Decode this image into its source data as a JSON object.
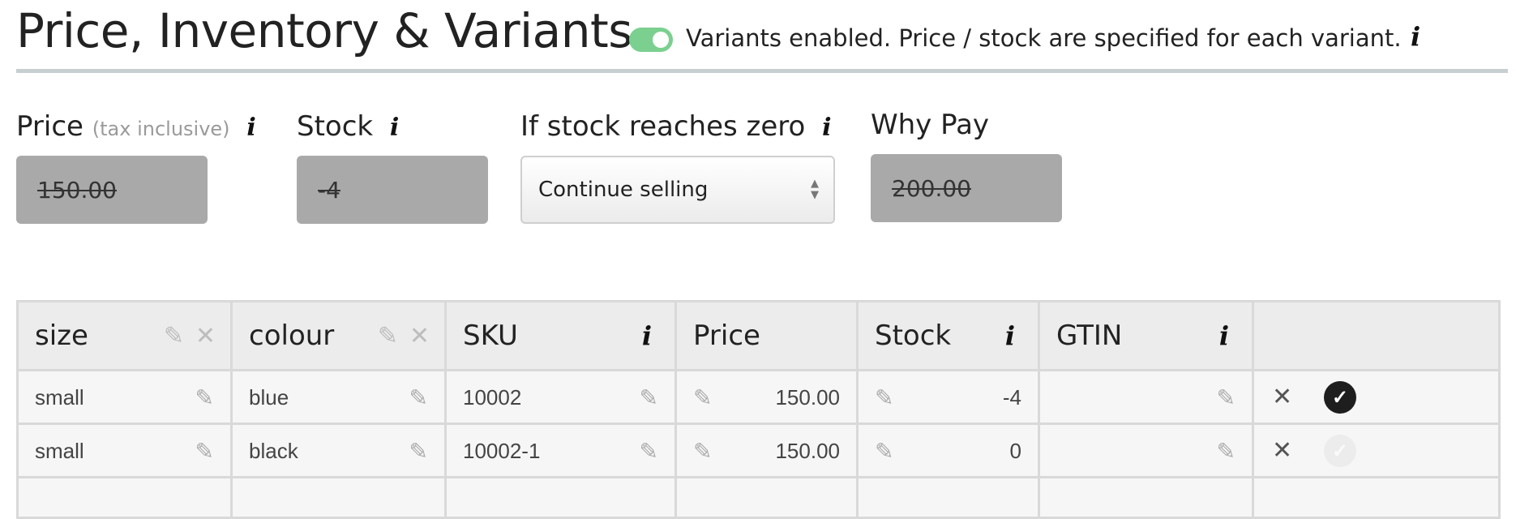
{
  "header": {
    "title": "Price, Inventory & Variants",
    "variants_toggle_on": true,
    "variants_message": "Variants enabled. Price / stock are specified for each variant.",
    "info_glyph": "i"
  },
  "fields": {
    "price_label": "Price",
    "price_sublabel": "(tax inclusive)",
    "price_value": "150.00",
    "stock_label": "Stock",
    "stock_value": "-4",
    "zero_label": "If stock reaches zero",
    "zero_selected": "Continue selling",
    "why_pay_label": "Why Pay",
    "why_pay_value": "200.00"
  },
  "table": {
    "headers": {
      "size": "size",
      "colour": "colour",
      "sku": "SKU",
      "price": "Price",
      "stock": "Stock",
      "gtin": "GTIN"
    },
    "rows": [
      {
        "size": "small",
        "colour": "blue",
        "sku": "10002",
        "price": "150.00",
        "stock": "-4",
        "gtin": "",
        "active": true
      },
      {
        "size": "small",
        "colour": "black",
        "sku": "10002-1",
        "price": "150.00",
        "stock": "0",
        "gtin": "",
        "active": false
      }
    ]
  },
  "icons": {
    "info": "info-icon",
    "edit": "pencil-icon",
    "remove": "close-icon",
    "active": "check-circle-icon",
    "select": "select-arrows-icon"
  },
  "colors": {
    "toggle_on": "#7bd08f",
    "disabled_input": "#a9a9a9",
    "table_border": "#d9d9d9",
    "header_rule": "#c7cfd1"
  }
}
